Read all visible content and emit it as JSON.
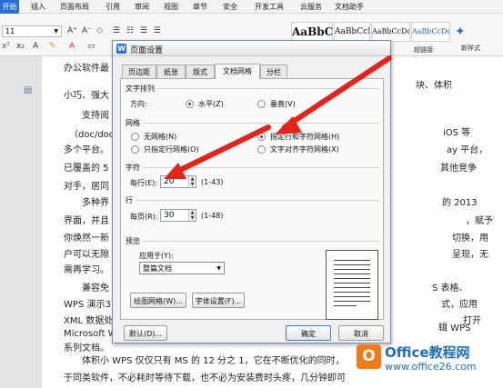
{
  "menubar": {
    "items": [
      "开始",
      "插入",
      "页面布局",
      "引用",
      "审阅",
      "视图",
      "章节",
      "安全",
      "开发工具",
      "云服务",
      "文档助手"
    ]
  },
  "ribbon": {
    "font_size": "11",
    "styles": [
      "AaBbC",
      "AaBbCcD",
      "AaBbCcDd",
      "AaBbCcDd"
    ],
    "super_link": "超链接",
    "new_style": "新样式"
  },
  "doc": {
    "lines": [
      "办公软件最",
      "块、体积",
      "小巧、强大",
      "支持阅",
      "iOS 等",
      "（doc/docx",
      "ay 平台，",
      "多个平台。",
      "其他竞争",
      "已覆盖的 5",
      "",
      "对手，居同",
      "",
      "多种界",
      "的 2013",
      "界面，并且",
      "，赋予",
      "你焕然一新",
      "切换，用",
      "户可以无隙",
      "呈现，无",
      "需再学习。",
      "",
      "兼容免",
      "S 表格、",
      "WPS 演示3",
      "式，应用",
      "XML 数据处",
      "打开",
      "Microsoft W",
      "辑 WPS",
      "系列文档。",
      "体积小 WPS 仅仅只有 MS 的 12 分之 1，它在不断优化的同时，",
      "于同类软件，不必耗时等待下载，也不必为安装费时头疼，几分钟即可"
    ]
  },
  "dialog": {
    "title": "页面设置",
    "tabs": [
      "页边距",
      "纸张",
      "版式",
      "文档网格",
      "分栏"
    ],
    "text_direction": {
      "heading": "文字排列",
      "direction_label": "方向:",
      "horizontal": "水平(Z)",
      "vertical": "垂直(V)"
    },
    "grid": {
      "heading": "网格",
      "no_grid": "无网格(N)",
      "line_only": "只指定行网格(O)",
      "line_and_char": "指定行和字符网格(H)",
      "snap_chars": "文字对齐字符网格(X)"
    },
    "chars": {
      "heading": "字符",
      "per_line_label": "每行(E):",
      "per_line_value": "20",
      "per_line_range": "(1-43)"
    },
    "lines": {
      "heading": "行",
      "per_page_label": "每页(R):",
      "per_page_value": "30",
      "per_page_range": "(1-48)"
    },
    "preview": {
      "heading": "预览",
      "apply_label": "应用于(Y):",
      "apply_value": "整篇文档"
    },
    "buttons": {
      "draw_grid": "绘图网格(W)...",
      "font_settings": "字体设置(F)...",
      "default": "默认(D)...",
      "ok": "确定",
      "cancel": "取消"
    }
  },
  "watermark": {
    "logo": "O",
    "name": "Office教程网",
    "url": "www.office26.com"
  },
  "colors": {
    "arrow": "#e3241a",
    "accent": "#2b6fd6",
    "watermark": "#1f6fc0"
  }
}
